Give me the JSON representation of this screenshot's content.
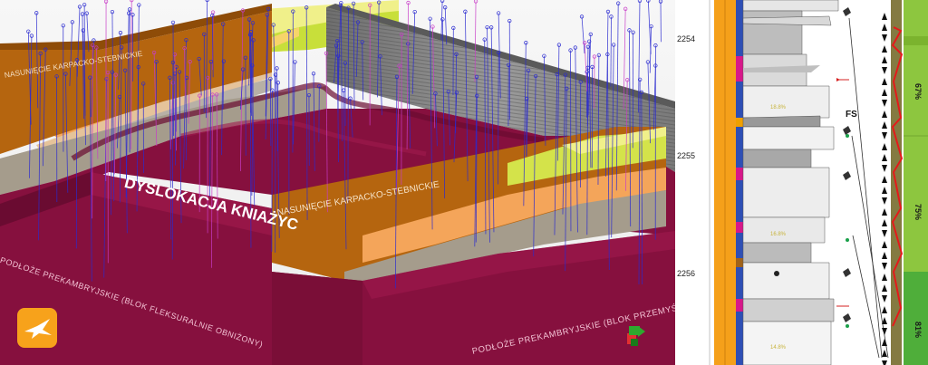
{
  "scene": {
    "labels": {
      "thrust_left": "NASUNIĘCIE KARPACKO-STEBNICKIE",
      "dislocation": "DYSLOKACJA KNIAŻYC",
      "thrust_right": "NASUNIĘCIE KARPACKO-STEBNICKIE",
      "basement_left": "PODŁOŻE PREKAMBRYJSKIE (BLOK FLEKSURALNIE OBNIŻONY)",
      "basement_right": "PODŁOŻE PREKAMBRYJSKIE (BLOK PRZEMYŚLA)"
    },
    "colors": {
      "carpathian_block": "#b5650f",
      "basement": "#86103e",
      "basement_dark": "#6a0b31",
      "logo": "#f7a21b"
    },
    "logo_icon": "bird-icon",
    "axis_icon": "axis-gizmo-icon"
  },
  "log": {
    "depths": [
      "2254",
      "2255",
      "2256"
    ],
    "marker": "FS",
    "percentages": [
      "67%",
      "75%",
      "81%"
    ],
    "icons": [
      "leaf-icon",
      "arrow-up-icon",
      "green-dot-icon",
      "red-arrow-icon"
    ]
  }
}
